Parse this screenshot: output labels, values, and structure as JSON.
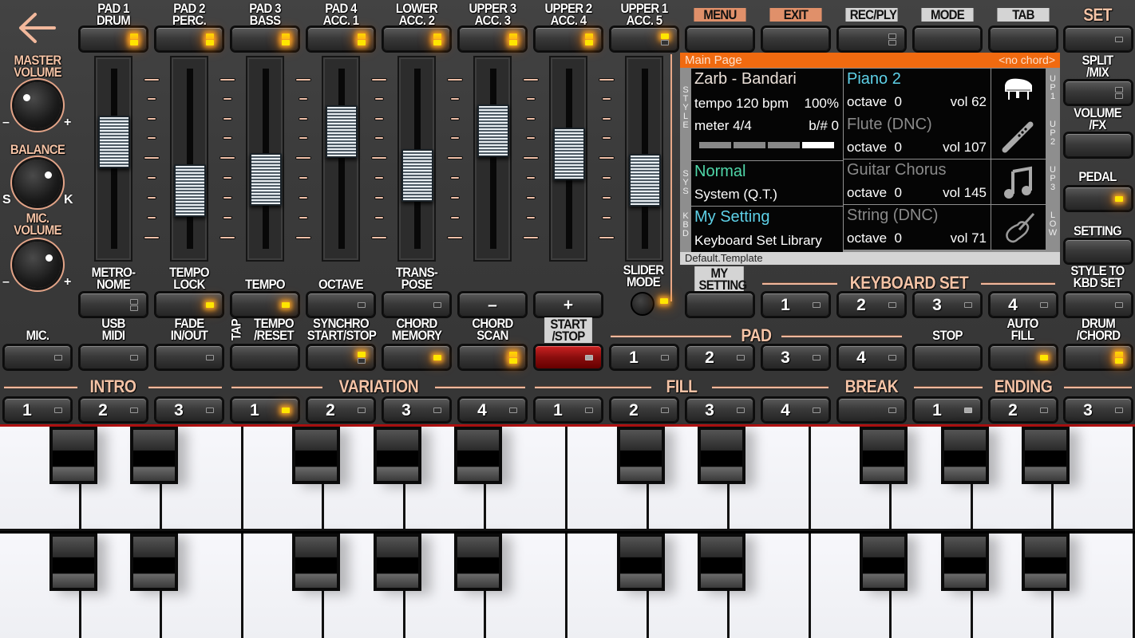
{
  "back": {
    "icon": "back-arrow-icon"
  },
  "top_row": [
    {
      "label": "PAD 1\nDRUM",
      "led": "on2"
    },
    {
      "label": "PAD 2\nPERC.",
      "led": "on2"
    },
    {
      "label": "PAD 3\nBASS",
      "led": "on2"
    },
    {
      "label": "PAD 4\nACC. 1",
      "led": "on2"
    },
    {
      "label": "LOWER\nACC. 2",
      "led": "on2"
    },
    {
      "label": "UPPER 3\nACC. 3",
      "led": "on2"
    },
    {
      "label": "UPPER 2\nACC. 4",
      "led": "on2"
    },
    {
      "label": "UPPER 1\nACC. 5",
      "led": "on-off"
    }
  ],
  "menu_row": [
    {
      "label": "MENU",
      "style": "orange"
    },
    {
      "label": "EXIT",
      "style": "orange"
    },
    {
      "label": "REC/PLY",
      "style": "grey",
      "led": "off2"
    },
    {
      "label": "MODE",
      "style": "grey"
    },
    {
      "label": "TAB",
      "style": "grey"
    }
  ],
  "right_column": [
    {
      "label": "SET",
      "led": "off"
    },
    {
      "label": "SPLIT\n/MIX",
      "led": "off2"
    },
    {
      "label": "VOLUME\n/FX",
      "led": "none"
    },
    {
      "label": "PEDAL",
      "led": "on"
    },
    {
      "label": "SETTING",
      "led": "none"
    },
    {
      "label": "STYLE TO\nKBD SET",
      "led": "off"
    }
  ],
  "knobs": [
    {
      "label": "MASTER\nVOLUME",
      "min": "–",
      "max": "+",
      "value": 0.3
    },
    {
      "label": "BALANCE",
      "min": "S",
      "max": "K",
      "value": 0.7
    },
    {
      "label": "MIC.\nVOLUME",
      "min": "–",
      "max": "+",
      "value": 0.72
    }
  ],
  "sliders": [
    {
      "name": "pad1-drum",
      "value": 0.63
    },
    {
      "name": "pad2-perc",
      "value": 0.25
    },
    {
      "name": "pad3-bass",
      "value": 0.34
    },
    {
      "name": "pad4-acc1",
      "value": 0.71
    },
    {
      "name": "lower-acc2",
      "value": 0.37
    },
    {
      "name": "upper3-acc3",
      "value": 0.72
    },
    {
      "name": "upper2-acc4",
      "value": 0.54
    },
    {
      "name": "upper1-acc5",
      "value": 0.33
    }
  ],
  "display": {
    "header": "Main Page",
    "chord": "<no chord>",
    "footer": "Default.Template",
    "style_letters": "S\nT\nY\nL\nE",
    "sys_letters": "S\nY\nS",
    "kbd_letters": "K\nB\nD",
    "style": {
      "name": "Zarb - Bandari",
      "tempo": "tempo 120 bpm",
      "tempo_pct": "100%",
      "meter": "meter 4/4",
      "keysig": "b/#  0",
      "beat_total": 4,
      "beat_current": 4
    },
    "sys": {
      "name": "Normal",
      "sub": "System (Q.T.)"
    },
    "kbd": {
      "name": "My Setting",
      "sub": "Keyboard Set Library"
    },
    "parts": [
      {
        "name": "Piano 2",
        "octave": "octave  0",
        "vol": "vol 62",
        "side": "U\nP\n1",
        "icon": "piano-icon",
        "active": true
      },
      {
        "name": "Flute (DNC)",
        "octave": "octave  0",
        "vol": "vol 107",
        "side": "U\nP\n2",
        "icon": "flute-icon",
        "active": false
      },
      {
        "name": "Guitar Chorus",
        "octave": "octave  0",
        "vol": "vol 145",
        "side": "U\nP\n3",
        "icon": "music-note-icon",
        "active": false
      },
      {
        "name": "String (DNC)",
        "octave": "octave  0",
        "vol": "vol 71",
        "side": "L\nO\nW",
        "icon": "violin-icon",
        "active": false
      }
    ]
  },
  "row2": [
    {
      "label": "METRO-\nNOME",
      "led": "off2"
    },
    {
      "label": "TEMPO\nLOCK",
      "led": "on"
    },
    {
      "label": "TEMPO",
      "led": "on"
    },
    {
      "label": "OCTAVE",
      "led": "off"
    },
    {
      "label": "TRANS-\nPOSE",
      "led": "off"
    }
  ],
  "tempo_minus": "–",
  "tempo_plus": "+",
  "slider_mode": {
    "label": "SLIDER\nMODE"
  },
  "my_setting": {
    "label": "MY\nSETTING"
  },
  "keyboard_set": {
    "title": "KEYBOARD SET",
    "buttons": [
      "1",
      "2",
      "3",
      "4"
    ]
  },
  "row3": [
    {
      "label": "MIC.",
      "led": "off"
    },
    {
      "label": "USB\nMIDI",
      "led": "off"
    },
    {
      "label": "FADE\nIN/OUT",
      "led": "off"
    },
    {
      "label": "TEMPO\n/RESET",
      "tap": "TAP",
      "led": "none"
    },
    {
      "label": "SYNCHRO\nSTART/STOP",
      "led": "on-off"
    },
    {
      "label": "CHORD\nMEMORY",
      "led": "on"
    },
    {
      "label": "CHORD\nSCAN",
      "led": "on2"
    },
    {
      "label": "START\n/STOP",
      "led": "grey",
      "red": true
    }
  ],
  "pad": {
    "title": "PAD",
    "buttons": [
      "1",
      "2",
      "3",
      "4"
    ]
  },
  "stop": {
    "label": "STOP"
  },
  "auto_fill": {
    "label": "AUTO\nFILL",
    "led": "on"
  },
  "drum_chord": {
    "label": "DRUM\n/CHORD",
    "led": "on2"
  },
  "arranger": {
    "intro": {
      "title": "INTRO",
      "buttons": [
        "1",
        "2",
        "3"
      ]
    },
    "variation": {
      "title": "VARIATION",
      "buttons": [
        "1",
        "2",
        "3",
        "4"
      ],
      "active": 0
    },
    "fill": {
      "title": "FILL",
      "buttons": [
        "1",
        "2",
        "3",
        "4"
      ]
    },
    "break": {
      "title": "BREAK"
    },
    "ending": {
      "title": "ENDING",
      "buttons": [
        "1",
        "2",
        "3"
      ],
      "grey": 0
    }
  },
  "keyboard": {
    "rows": 2,
    "white_keys_per_row": 14,
    "black_key_pattern": [
      1,
      1,
      0,
      1,
      1,
      1,
      0,
      1,
      1,
      0,
      1,
      1,
      1,
      0
    ]
  }
}
